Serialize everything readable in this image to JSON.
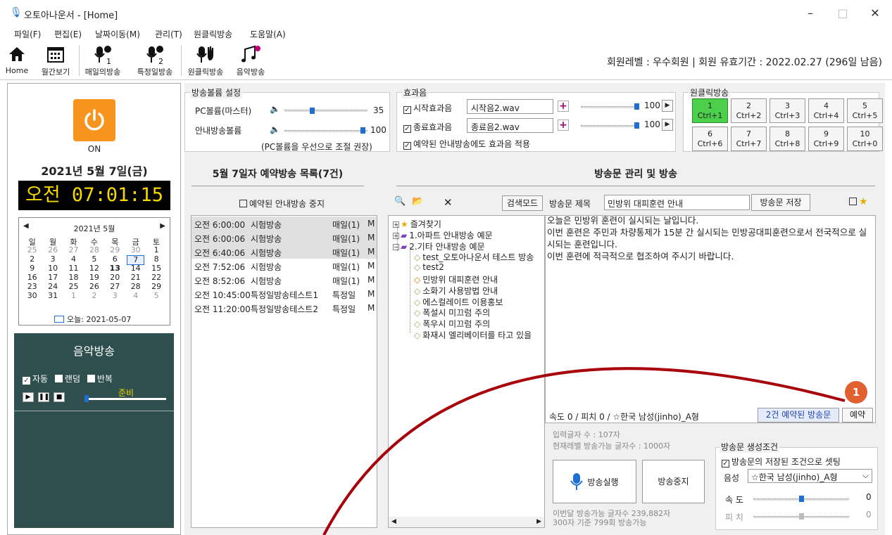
{
  "window": {
    "title": "오토아나운서 - [Home]"
  },
  "menu": [
    "파일(F)",
    "편집(E)",
    "날짜이동(M)",
    "관리(T)",
    "원클릭방송",
    "도움말(A)"
  ],
  "toolbar": {
    "home": "Home",
    "month": "월간보기",
    "daily": "매일의방송",
    "special": "특정일방송",
    "oneclick": "원클릭방송",
    "music": "음악방송",
    "member": "회원레벨 : 우수회원  |  회원 유효기간 : 2022.02.27 (296일 남음)"
  },
  "power": {
    "label": "ON",
    "color": "#f7941d"
  },
  "date": {
    "display": "2021년 5월 7일(금)",
    "clock": "오전 07:01:15"
  },
  "calendar": {
    "title": "2021년 5월",
    "weekdays": [
      "일",
      "월",
      "화",
      "수",
      "목",
      "금",
      "토"
    ],
    "weeks": [
      [
        "25",
        "26",
        "27",
        "28",
        "29",
        "30",
        "1"
      ],
      [
        "2",
        "3",
        "4",
        "5",
        "6",
        "7",
        "8"
      ],
      [
        "9",
        "10",
        "11",
        "12",
        "13",
        "14",
        "15"
      ],
      [
        "16",
        "17",
        "18",
        "19",
        "20",
        "21",
        "22"
      ],
      [
        "23",
        "24",
        "25",
        "26",
        "27",
        "28",
        "29"
      ],
      [
        "30",
        "31",
        "1",
        "2",
        "3",
        "4",
        "5"
      ]
    ],
    "today": "오늘: 2021-05-07"
  },
  "music": {
    "title": "음악방송",
    "auto": "자동",
    "random": "랜덤",
    "repeat": "반복",
    "status": "준비"
  },
  "volume": {
    "group": "방송볼륨 설정",
    "pc": "PC볼륨(마스터)",
    "pc_val": "35",
    "pc_level": 0.35,
    "announce": "안내방송볼륨",
    "ann_val": "100",
    "ann_level": 1.0,
    "hint": "(PC볼륨을 우선으로 조절 권장)"
  },
  "effects": {
    "group": "효과음",
    "start": "시작효과음",
    "start_file": "시작음2.wav",
    "start_val": "100",
    "end": "종료효과음",
    "end_file": "종료음2.wav",
    "end_val": "100",
    "apply": "예약된 안내방송에도 효과음 적용"
  },
  "oneclick": {
    "group": "원클릭방송",
    "buttons": [
      [
        "1",
        "Ctrl+1"
      ],
      [
        "2",
        "Ctrl+2"
      ],
      [
        "3",
        "Ctrl+3"
      ],
      [
        "4",
        "Ctrl+4"
      ],
      [
        "5",
        "Ctrl+5"
      ],
      [
        "6",
        "Ctrl+6"
      ],
      [
        "7",
        "Ctrl+7"
      ],
      [
        "8",
        "Ctrl+8"
      ],
      [
        "9",
        "Ctrl+9"
      ],
      [
        "10",
        "Ctrl+0"
      ]
    ]
  },
  "schedule": {
    "title": "5월 7일자 예약방송 목록(7건)",
    "stop": "예약된 안내방송 중지",
    "rows": [
      [
        "오전 6:00:00",
        "시험방송",
        "매일(1)",
        "M"
      ],
      [
        "오전 6:00:06",
        "시험방송",
        "매일(1)",
        "M"
      ],
      [
        "오전 6:40:06",
        "시험방송",
        "매일(1)",
        "M"
      ],
      [
        "오전 7:52:06",
        "시험방송",
        "매일(1)",
        "M"
      ],
      [
        "오전 8:52:06",
        "시험방송",
        "매일(1)",
        "M"
      ],
      [
        "오전 10:45:00",
        "특정일방송테스트1",
        "특정일",
        "M"
      ],
      [
        "오전 11:20:00",
        "특정일방송테스트2",
        "특정일",
        "M"
      ]
    ]
  },
  "scripts": {
    "title": "방송문 관리 및 방송",
    "search": "검색모드",
    "label": "방송문 제목",
    "value": "민방위 대피훈련 안내",
    "save": "방송문 저장",
    "tree": [
      "즐겨찾기",
      "1.아파트 안내방송 예문",
      "2.기타 안내방송 예문",
      "test_오토아나운서 테스트 방송",
      "test2",
      "민방위 대피훈련 안내",
      "소화기 사용방법 안내",
      "에스컬레이트 이용홍보",
      "폭설시 미끄럼 주의",
      "폭우시 미끄럼 주의",
      "화재시 엘리베이터를 타고 있을"
    ],
    "body": [
      "오늘은 민방위 훈련이 실시되는 날입니다.",
      "이번 훈련은 주민과 차량통제가 15분 간 실시되는 민방공대피훈련으로서 전국적으로 실시되는 훈련입니다.",
      "이번 훈련에 적극적으로 협조하여 주시기 바랍니다."
    ],
    "status": "속도 0 / 피치 0 / ☆한국 남성(jinho)_A형",
    "reserved": "2건 예약된 방송문",
    "reserve": "예약",
    "badge": "1",
    "count": "입력글자 수 : 107자",
    "limit": "현재레벨 방송가능 글자수 : 1000자",
    "play": "방송실행",
    "stop": "방송중지",
    "monthly1": "이번달 방송가능 글자수 239,882자",
    "monthly2": "300자 기준 799회 방송가능"
  },
  "gen": {
    "group": "방송문 생성조건",
    "saved": "방송문의 저장된 조건으로 셋팅",
    "voice_l": "음성",
    "voice": "☆한국 남성(jinho)_A형",
    "speed_l": "속 도",
    "speed": "0",
    "pitch_l": "피 치",
    "pitch": "0"
  }
}
